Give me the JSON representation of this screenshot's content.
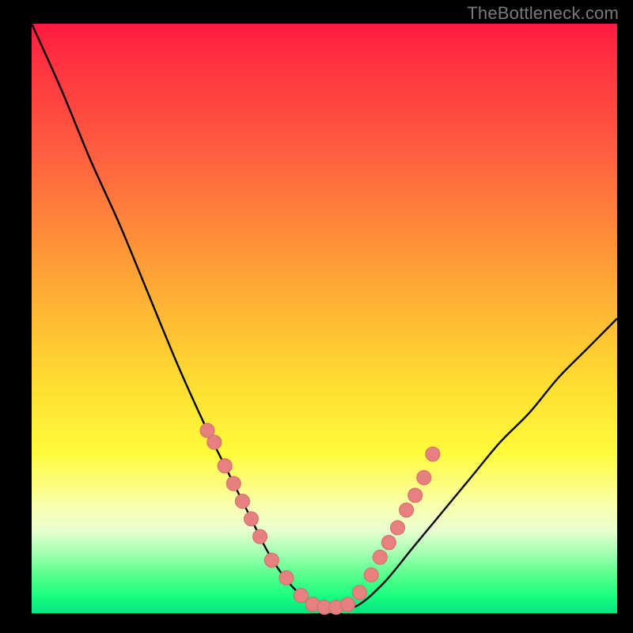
{
  "watermark": "TheBottleneck.com",
  "colors": {
    "background": "#000000",
    "curve": "#000000",
    "marker_fill": "#e98080",
    "marker_stroke": "#d06a6a"
  },
  "chart_data": {
    "type": "line",
    "title": "",
    "xlabel": "",
    "ylabel": "",
    "xlim": [
      0,
      100
    ],
    "ylim": [
      0,
      100
    ],
    "x": [
      0,
      5,
      10,
      15,
      20,
      25,
      30,
      32.5,
      35,
      37.5,
      40,
      42.5,
      45,
      47.5,
      50,
      55,
      60,
      65,
      70,
      75,
      80,
      85,
      90,
      95,
      100
    ],
    "values": [
      100,
      89,
      77,
      66,
      54,
      42,
      31,
      26,
      21,
      16,
      11,
      7,
      4,
      2,
      1,
      1,
      5,
      11,
      17,
      23,
      29,
      34,
      40,
      45,
      50
    ],
    "marker_points": [
      {
        "x": 30,
        "y": 31
      },
      {
        "x": 31.2,
        "y": 29
      },
      {
        "x": 33,
        "y": 25
      },
      {
        "x": 34.5,
        "y": 22
      },
      {
        "x": 36,
        "y": 19
      },
      {
        "x": 37.5,
        "y": 16
      },
      {
        "x": 39,
        "y": 13
      },
      {
        "x": 41,
        "y": 9
      },
      {
        "x": 43.5,
        "y": 6
      },
      {
        "x": 46,
        "y": 3
      },
      {
        "x": 48,
        "y": 1.5
      },
      {
        "x": 50,
        "y": 1
      },
      {
        "x": 52,
        "y": 1
      },
      {
        "x": 54,
        "y": 1.5
      },
      {
        "x": 56,
        "y": 3.5
      },
      {
        "x": 58,
        "y": 6.5
      },
      {
        "x": 59.5,
        "y": 9.5
      },
      {
        "x": 61,
        "y": 12
      },
      {
        "x": 62.5,
        "y": 14.5
      },
      {
        "x": 64,
        "y": 17.5
      },
      {
        "x": 65.5,
        "y": 20
      },
      {
        "x": 67,
        "y": 23
      },
      {
        "x": 68.5,
        "y": 27
      }
    ]
  }
}
